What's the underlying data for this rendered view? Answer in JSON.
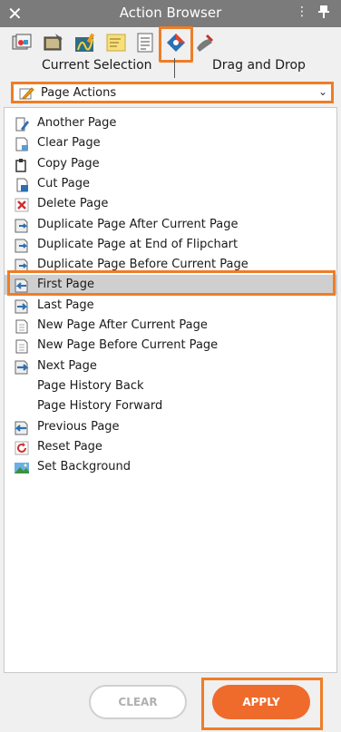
{
  "window": {
    "title": "Action Browser",
    "close_glyph": "✕",
    "menu_glyph": "⋮"
  },
  "toolbar": {
    "icons": [
      "actions-icon",
      "media-icon",
      "signature-icon",
      "sticky-note-icon",
      "list-icon",
      "page-actions-icon",
      "tool-icon"
    ],
    "selected_index": 5
  },
  "modes": {
    "current_selection": "Current Selection",
    "drag_and_drop": "Drag and Drop"
  },
  "category": {
    "selected": "Page Actions",
    "caret": "⌄"
  },
  "actions": [
    {
      "label": "Another Page",
      "icon": "another-page-icon"
    },
    {
      "label": "Clear Page",
      "icon": "clear-page-icon"
    },
    {
      "label": "Copy Page",
      "icon": "copy-page-icon"
    },
    {
      "label": "Cut Page",
      "icon": "cut-page-icon"
    },
    {
      "label": "Delete Page",
      "icon": "delete-page-icon"
    },
    {
      "label": "Duplicate Page After Current Page",
      "icon": "duplicate-page-icon"
    },
    {
      "label": "Duplicate Page at End of Flipchart",
      "icon": "duplicate-page-icon"
    },
    {
      "label": "Duplicate Page Before Current Page",
      "icon": "duplicate-page-icon"
    },
    {
      "label": "First Page",
      "icon": "first-page-icon"
    },
    {
      "label": "Last Page",
      "icon": "last-page-icon"
    },
    {
      "label": "New Page After Current Page",
      "icon": "new-page-icon"
    },
    {
      "label": "New Page Before Current Page",
      "icon": "new-page-icon"
    },
    {
      "label": "Next Page",
      "icon": "next-page-icon"
    },
    {
      "label": "Page History Back",
      "icon": ""
    },
    {
      "label": "Page History Forward",
      "icon": ""
    },
    {
      "label": "Previous Page",
      "icon": "previous-page-icon"
    },
    {
      "label": "Reset Page",
      "icon": "reset-page-icon"
    },
    {
      "label": "Set Background",
      "icon": "set-background-icon"
    }
  ],
  "selected_action_index": 8,
  "buttons": {
    "clear": "CLEAR",
    "apply": "APPLY"
  },
  "colors": {
    "accent": "#ee7d27",
    "apply": "#ef6b2c",
    "titlebar": "#7b7b7b"
  }
}
